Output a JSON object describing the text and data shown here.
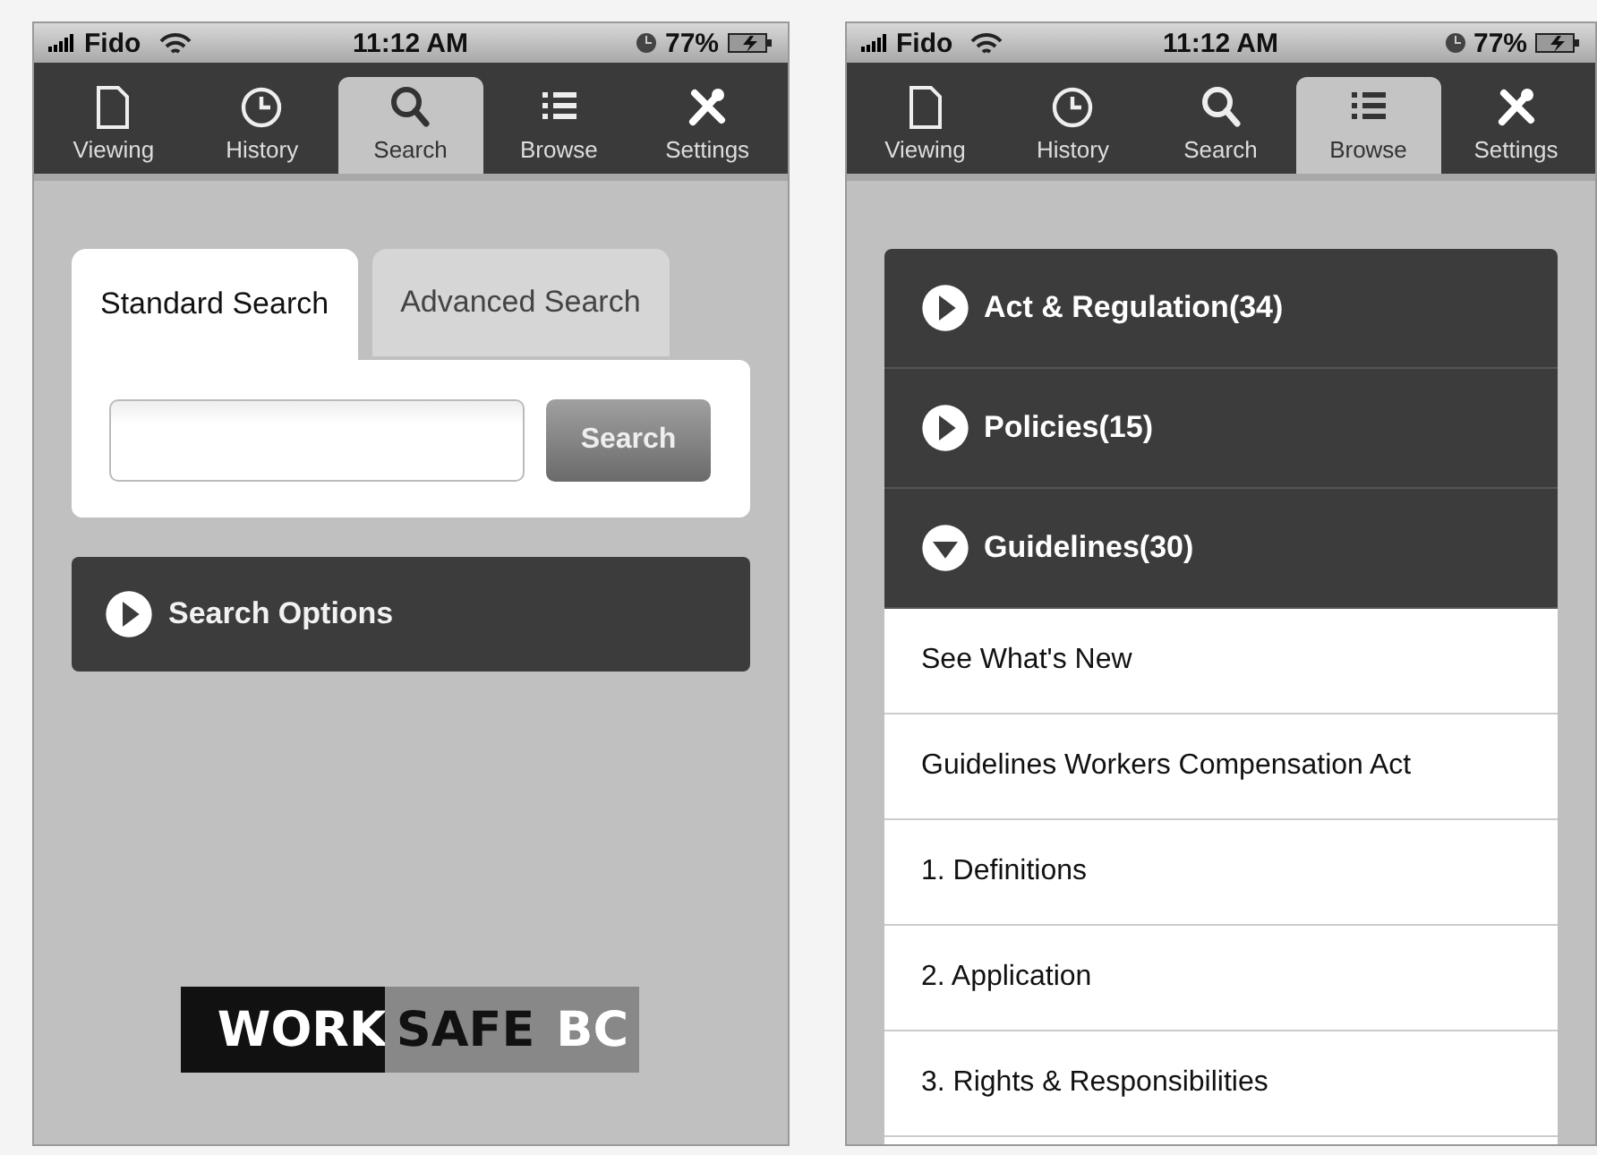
{
  "screens": [
    {
      "kind": "search",
      "status_bar": {
        "carrier": "Fido",
        "time": "11:12 AM",
        "battery": "77%"
      },
      "tab_bar": [
        {
          "kind": "document",
          "label": "Viewing",
          "selected": false
        },
        {
          "kind": "clock",
          "label": "History",
          "selected": false
        },
        {
          "kind": "search",
          "label": "Search",
          "selected": true
        },
        {
          "kind": "list",
          "label": "Browse",
          "selected": false
        },
        {
          "kind": "tools",
          "label": "Settings",
          "selected": false
        }
      ],
      "search_tabs": [
        {
          "label": "Standard Search",
          "selected": true
        },
        {
          "label": "Advanced Search",
          "selected": false
        }
      ],
      "search_button": "Search",
      "options": {
        "label": "Search Options",
        "expanded": false
      },
      "logo": {
        "word_1": "WORK",
        "word_2": "SAFE",
        "word_3": "BC"
      }
    },
    {
      "kind": "browse",
      "status_bar": {
        "carrier": "Fido",
        "time": "11:12 AM",
        "battery": "77%"
      },
      "tab_bar": [
        {
          "kind": "document",
          "label": "Viewing",
          "selected": false
        },
        {
          "kind": "clock",
          "label": "History",
          "selected": false
        },
        {
          "kind": "search",
          "label": "Search",
          "selected": false
        },
        {
          "kind": "list",
          "label": "Browse",
          "selected": true
        },
        {
          "kind": "tools",
          "label": "Settings",
          "selected": false
        }
      ],
      "categories": [
        {
          "label": "Act & Regulation(34)",
          "expanded": false
        },
        {
          "label": "Policies(15)",
          "expanded": false
        },
        {
          "label": "Guidelines(30)",
          "expanded": true,
          "children": [
            {
              "label": "See What's New"
            },
            {
              "label": "Guidelines Workers Compensation Act"
            },
            {
              "label": "1. Definitions"
            },
            {
              "label": "2. Application"
            },
            {
              "label": "3. Rights & Responsibilities"
            }
          ]
        }
      ]
    }
  ]
}
